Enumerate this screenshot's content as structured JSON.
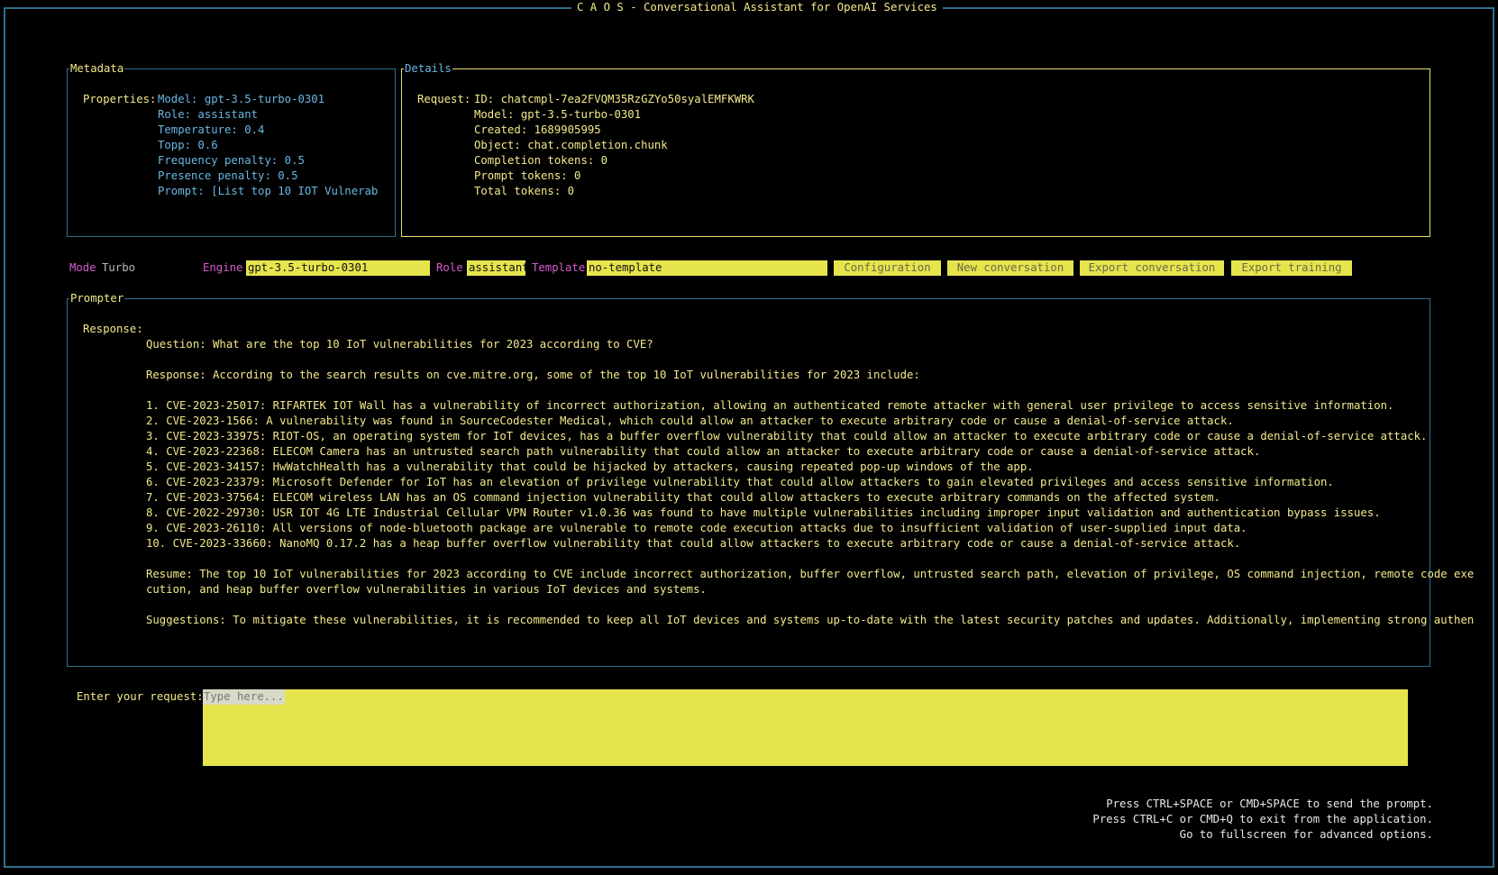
{
  "window": {
    "title": "C A O S - Conversational Assistant for OpenAI Services"
  },
  "metadata": {
    "title": "Metadata",
    "properties_label": "Properties:",
    "lines": [
      "Model: gpt-3.5-turbo-0301",
      "Role: assistant",
      "Temperature: 0.4",
      "Topp: 0.6",
      "Frequency penalty: 0.5",
      "Presence penalty: 0.5",
      "Prompt: [List top 10 IOT Vulnerab"
    ]
  },
  "details": {
    "title": "Details",
    "request_label": "Request:",
    "lines": [
      "ID: chatcmpl-7ea2FVQM35RzGZYo50syalEMFKWRK",
      "Model: gpt-3.5-turbo-0301",
      "Created: 1689905995",
      "Object: chat.completion.chunk",
      "Completion tokens: 0",
      "Prompt tokens: 0",
      "Total tokens: 0"
    ]
  },
  "toolbar": {
    "mode_label": "Mode",
    "mode_value": "Turbo",
    "engine_label": "Engine",
    "engine_value": "gpt-3.5-turbo-0301",
    "role_label": "Role",
    "role_value": "assistant",
    "template_label": "Template",
    "template_value": "no-template",
    "buttons": [
      "Configuration",
      "New conversation",
      "Export conversation",
      "Export training"
    ]
  },
  "prompter": {
    "title": "Prompter",
    "response_label": "Response:",
    "lines": [
      "Question: What are the top 10 IoT vulnerabilities for 2023 according to CVE?",
      "",
      "Response: According to the search results on cve.mitre.org, some of the top 10 IoT vulnerabilities for 2023 include:",
      "",
      "1. CVE-2023-25017: RIFARTEK IOT Wall has a vulnerability of incorrect authorization, allowing an authenticated remote attacker with general user privilege to access sensitive information.",
      "2. CVE-2023-1566: A vulnerability was found in SourceCodester Medical, which could allow an attacker to execute arbitrary code or cause a denial-of-service attack.",
      "3. CVE-2023-33975: RIOT-OS, an operating system for IoT devices, has a buffer overflow vulnerability that could allow an attacker to execute arbitrary code or cause a denial-of-service attack.",
      "4. CVE-2023-22368: ELECOM Camera has an untrusted search path vulnerability that could allow an attacker to execute arbitrary code or cause a denial-of-service attack.",
      "5. CVE-2023-34157: HwWatchHealth has a vulnerability that could be hijacked by attackers, causing repeated pop-up windows of the app.",
      "6. CVE-2023-23379: Microsoft Defender for IoT has an elevation of privilege vulnerability that could allow attackers to gain elevated privileges and access sensitive information.",
      "7. CVE-2023-37564: ELECOM wireless LAN has an OS command injection vulnerability that could allow attackers to execute arbitrary commands on the affected system.",
      "8. CVE-2022-29730: USR IOT 4G LTE Industrial Cellular VPN Router v1.0.36 was found to have multiple vulnerabilities including improper input validation and authentication bypass issues.",
      "9. CVE-2023-26110: All versions of node-bluetooth package are vulnerable to remote code execution attacks due to insufficient validation of user-supplied input data.",
      "10. CVE-2023-33660: NanoMQ 0.17.2 has a heap buffer overflow vulnerability that could allow attackers to execute arbitrary code or cause a denial-of-service attack.",
      "",
      "Resume: The top 10 IoT vulnerabilities for 2023 according to CVE include incorrect authorization, buffer overflow, untrusted search path, elevation of privilege, OS command injection, remote code exe",
      "cution, and heap buffer overflow vulnerabilities in various IoT devices and systems.",
      "",
      "Suggestions: To mitigate these vulnerabilities, it is recommended to keep all IoT devices and systems up-to-date with the latest security patches and updates. Additionally, implementing strong authen"
    ]
  },
  "request": {
    "label": "Enter your request:",
    "placeholder": "Type here..."
  },
  "footer": {
    "lines": [
      "Press CTRL+SPACE or CMD+SPACE to send the prompt.",
      "Press CTRL+C or CMD+Q to exit from the application.",
      "Go to fullscreen for advanced options."
    ]
  },
  "colors": {
    "background": "#000000",
    "border": "#2f6f8f",
    "text_yellow": "#f3e98a",
    "text_blue": "#69b7e3",
    "label_pink": "#d85bd0",
    "field_yellow": "#e6e44c"
  }
}
